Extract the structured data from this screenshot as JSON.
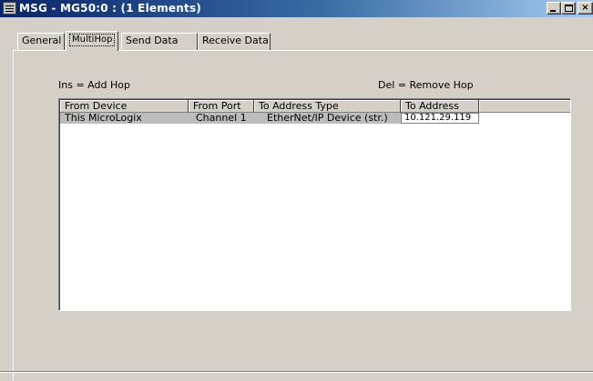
{
  "window": {
    "title": "MSG - MG50:0 : (1 Elements)"
  },
  "title_controls": {
    "minimize": "_",
    "maximize": "□",
    "close": "×"
  },
  "tabs": [
    {
      "label": "General",
      "selected": false
    },
    {
      "label": "MultiHop",
      "selected": true
    },
    {
      "label": "Send Data",
      "selected": false
    },
    {
      "label": "Receive Data",
      "selected": false
    }
  ],
  "hints": {
    "add": "Ins = Add Hop",
    "remove": "Del = Remove Hop"
  },
  "table": {
    "columns": [
      "From Device",
      "From Port",
      "To Address Type",
      "To Address"
    ],
    "rows": [
      {
        "from_device": "This MicroLogix",
        "from_port": "Channel 1",
        "to_address_type": "EtherNet/IP Device (str.)",
        "to_address": "10.121.29.119"
      }
    ]
  }
}
